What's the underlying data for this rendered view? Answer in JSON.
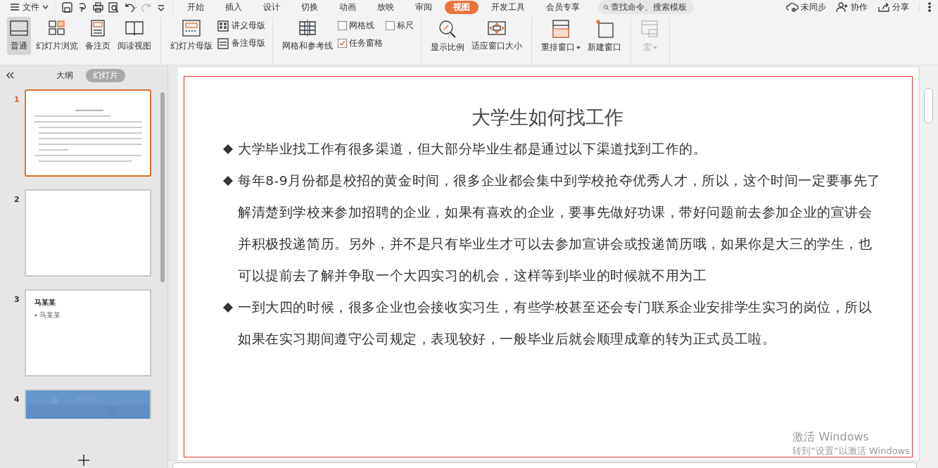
{
  "menu": {
    "label": "文件"
  },
  "ribbon_tabs": [
    {
      "label": "开始",
      "selected": false
    },
    {
      "label": "插入",
      "selected": false
    },
    {
      "label": "设计",
      "selected": false
    },
    {
      "label": "切换",
      "selected": false
    },
    {
      "label": "动画",
      "selected": false
    },
    {
      "label": "放映",
      "selected": false
    },
    {
      "label": "审阅",
      "selected": false
    },
    {
      "label": "视图",
      "selected": true
    },
    {
      "label": "开发工具",
      "selected": false
    },
    {
      "label": "会员专享",
      "selected": false
    }
  ],
  "search": {
    "placeholder": "查找命令、搜索模板"
  },
  "top_actions": [
    {
      "kind": "sync",
      "label": "未同步"
    },
    {
      "kind": "collab",
      "label": "协作"
    },
    {
      "kind": "share",
      "label": "分享"
    }
  ],
  "ribbon_groups": [
    {
      "items": [
        {
          "kind": "large",
          "label": "普通",
          "selected": true
        },
        {
          "kind": "large",
          "label": "幻灯片浏览",
          "selected": false
        },
        {
          "kind": "large",
          "label": "备注页",
          "selected": false
        },
        {
          "kind": "large",
          "label": "阅读视图",
          "selected": false
        }
      ]
    },
    {
      "items": [
        {
          "kind": "large",
          "label": "幻灯片母版",
          "selected": false
        },
        {
          "kind": "small",
          "label": "讲义母版"
        },
        {
          "kind": "small",
          "label": "备注母版"
        }
      ]
    },
    {
      "items": [
        {
          "kind": "large",
          "label": "网格和参考线",
          "selected": false
        },
        {
          "kind": "checkbox",
          "label": "网格线",
          "checked": false
        },
        {
          "kind": "checkbox",
          "label": "任务窗格",
          "checked": true
        },
        {
          "kind": "checkbox",
          "label": "标尺",
          "checked": false
        }
      ]
    },
    {
      "items": [
        {
          "kind": "large",
          "label": "显示比例",
          "selected": false
        },
        {
          "kind": "large",
          "label": "适应窗口大小",
          "selected": false
        }
      ]
    },
    {
      "items": [
        {
          "kind": "large",
          "label": "重排窗口",
          "selected": false,
          "dropdown": true,
          "disabled": false
        },
        {
          "kind": "large",
          "label": "新建窗口",
          "selected": false,
          "dropdown": false,
          "disabled": false
        }
      ]
    },
    {
      "items": [
        {
          "kind": "large",
          "label": "宏",
          "selected": false,
          "dropdown": true,
          "disabled": true
        }
      ]
    }
  ],
  "panel": {
    "tabs": [
      {
        "label": "大纲",
        "selected": false
      },
      {
        "label": "幻灯片",
        "selected": true
      }
    ],
    "thumbnails": [
      {
        "number": "1",
        "selected": true,
        "kind": "text"
      },
      {
        "number": "2",
        "selected": false,
        "kind": "blank"
      },
      {
        "number": "3",
        "selected": false,
        "kind": "title",
        "title": "马某某",
        "bullet": "马某某"
      },
      {
        "number": "4",
        "selected": false,
        "kind": "picture"
      }
    ]
  },
  "slide": {
    "title": "大学生如何找工作",
    "bullets": [
      "大学毕业找工作有很多渠道，但大部分毕业生都是通过以下渠道找到工作的。",
      "每年8-9月份都是校招的黄金时间，很多企业都会集中到学校抢夺优秀人才，所以，这个时间一定要事先了解清楚到学校来参加招聘的企业，如果有喜欢的企业，要事先做好功课，带好问题前去参加企业的宣讲会并积极投递简历。另外，并不是只有毕业生才可以去参加宣讲会或投递简历哦，如果你是大三的学生，也可以提前去了解并争取一个大四实习的机会，这样等到毕业的时候就不用为工",
      "一到大四的时候，很多企业也会接收实习生，有些学校甚至还会专门联系企业安排学生实习的岗位，所以如果在实习期间遵守公司规定，表现较好，一般毕业后就会顺理成章的转为正式员工啦。"
    ]
  },
  "activation": {
    "title": "激活 Windows",
    "hint": "转到“设置”以激活 Windows"
  }
}
